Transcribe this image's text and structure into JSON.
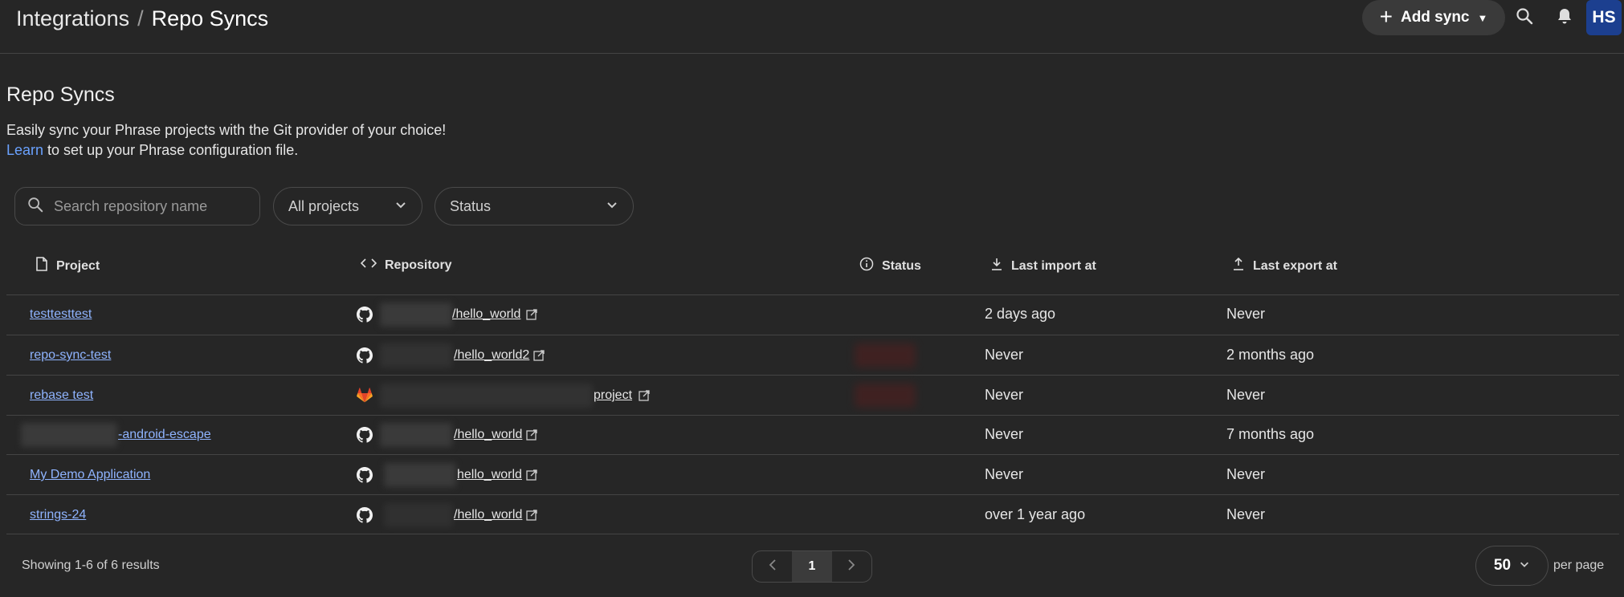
{
  "breadcrumb": {
    "parent": "Integrations",
    "separator": "/",
    "current": "Repo Syncs"
  },
  "header": {
    "add_sync_label": "Add sync",
    "avatar_initials": "HS"
  },
  "page": {
    "title": "Repo Syncs",
    "intro_line1": "Easily sync your Phrase projects with the Git provider of your choice!",
    "learn_link": "Learn",
    "intro_line2_rest": " to set up your Phrase configuration file."
  },
  "filters": {
    "search_placeholder": "Search repository name",
    "projects_value": "All projects",
    "status_value": "Status"
  },
  "table": {
    "columns": {
      "project": "Project",
      "repository": "Repository",
      "status": "Status",
      "last_import": "Last import at",
      "last_export": "Last export at"
    },
    "rows": [
      {
        "project": "testtesttest",
        "provider_icon": "github-icon",
        "repo": "/hello_world",
        "last_import": "2 days ago",
        "last_export": "Never"
      },
      {
        "project": "repo-sync-test",
        "provider_icon": "github-icon",
        "repo": "/hello_world2",
        "last_import": "Never",
        "last_export": "2 months ago"
      },
      {
        "project": "rebase test",
        "provider_icon": "gitlab-icon",
        "repo": "project",
        "last_import": "Never",
        "last_export": "Never"
      },
      {
        "project": "-android-escape",
        "provider_icon": "github-icon",
        "repo": "/hello_world",
        "last_import": "Never",
        "last_export": "7 months ago"
      },
      {
        "project": "My Demo Application",
        "provider_icon": "github-icon",
        "repo": "hello_world",
        "last_import": "Never",
        "last_export": "Never"
      },
      {
        "project": "strings-24",
        "provider_icon": "github-icon",
        "repo": "/hello_world",
        "last_import": "over 1 year ago",
        "last_export": "Never"
      }
    ]
  },
  "footer": {
    "showing": "Showing 1-6 of 6 results",
    "current_page": "1",
    "per_page_value": "50",
    "per_page_label": "per page"
  },
  "colors": {
    "background": "#262626",
    "link": "#8fb4ff",
    "avatar": "#1c3f8f",
    "gitlab": "#e2432a"
  }
}
